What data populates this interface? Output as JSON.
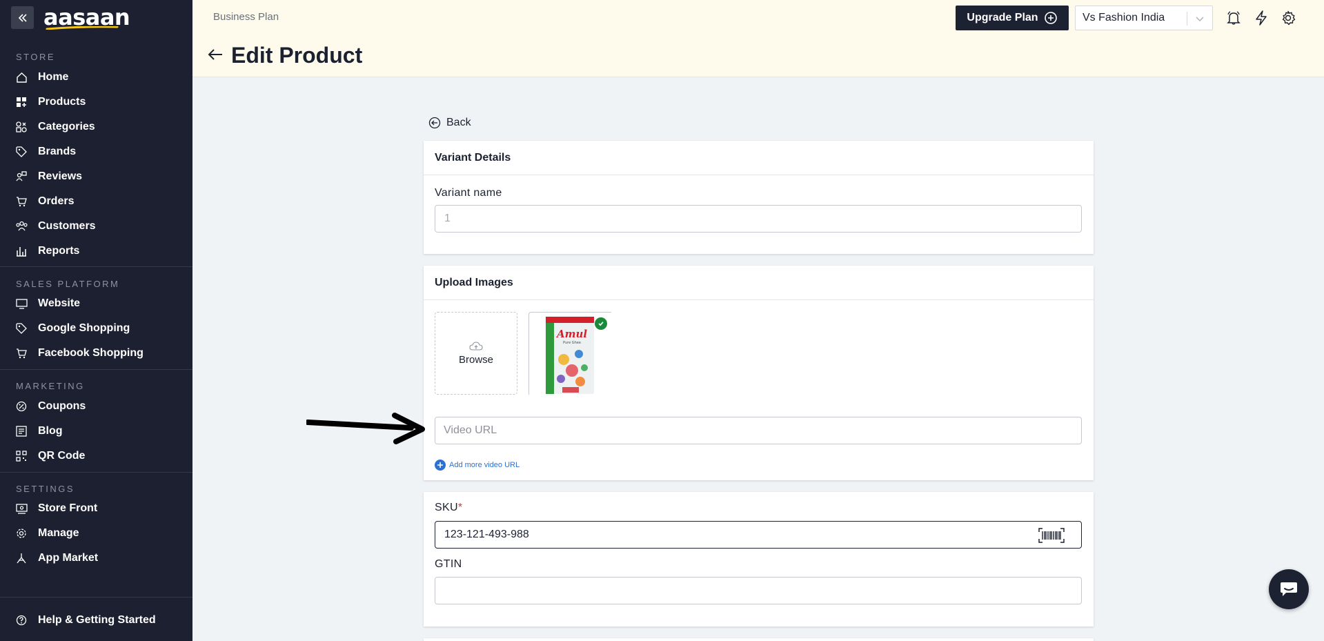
{
  "brand": {
    "logo_text": "aasaan",
    "accent": "#f5c518"
  },
  "sidebar": {
    "sections": [
      {
        "label": "STORE",
        "items": [
          "Home",
          "Products",
          "Categories",
          "Brands",
          "Reviews",
          "Orders",
          "Customers",
          "Reports"
        ]
      },
      {
        "label": "SALES PLATFORM",
        "items": [
          "Website",
          "Google Shopping",
          "Facebook Shopping"
        ]
      },
      {
        "label": "MARKETING",
        "items": [
          "Coupons",
          "Blog",
          "QR Code"
        ]
      },
      {
        "label": "SETTINGS",
        "items": [
          "Store Front",
          "Manage",
          "App Market"
        ]
      }
    ],
    "help_label": "Help & Getting Started"
  },
  "header": {
    "plan": "Business Plan",
    "title": "Edit Product",
    "upgrade_label": "Upgrade Plan",
    "store_name": "Vs Fashion India"
  },
  "content": {
    "back_label": "Back",
    "variant_card": {
      "title": "Variant Details",
      "name_label": "Variant name",
      "name_placeholder": "1"
    },
    "images_card": {
      "title": "Upload Images",
      "browse_label": "Browse",
      "image_text": "Amul",
      "image_subtext": "Pure Ghee",
      "video_placeholder": "Video URL",
      "add_more_label": "Add more video URL"
    },
    "sku_card": {
      "sku_label": "SKU",
      "sku_required_mark": "*",
      "sku_value": "123-121-493-988",
      "gtin_label": "GTIN",
      "gtin_value": ""
    }
  }
}
